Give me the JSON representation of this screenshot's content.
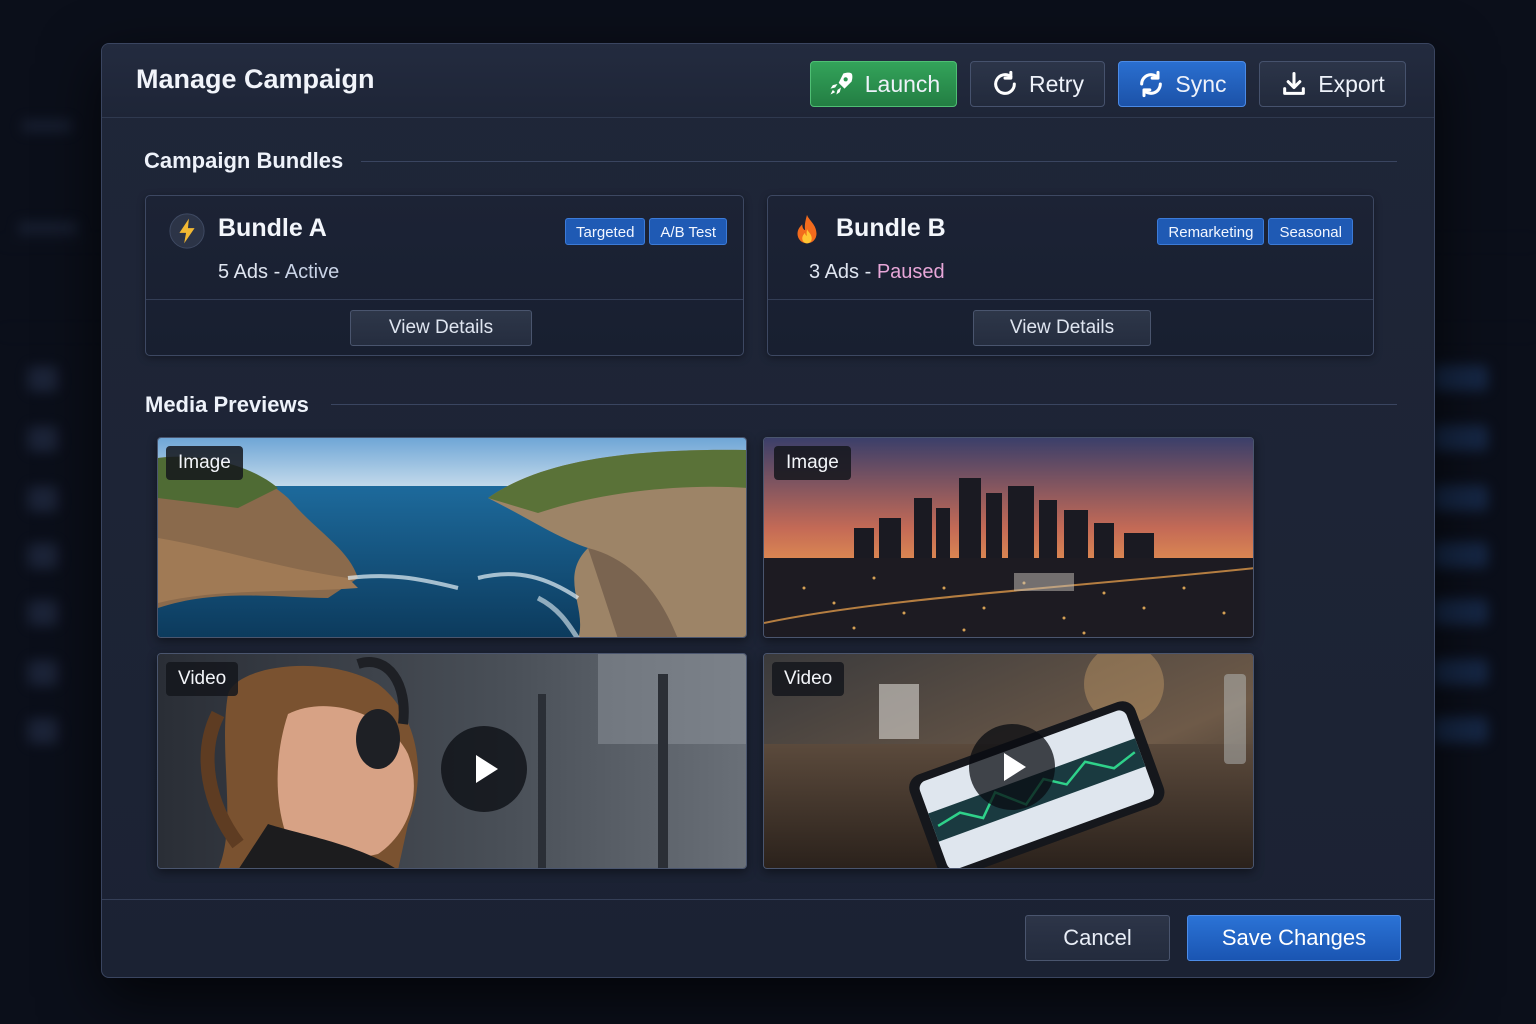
{
  "modal": {
    "title": "Manage Campaign"
  },
  "header_buttons": {
    "launch": "Launch",
    "retry": "Retry",
    "sync": "Sync",
    "export": "Export"
  },
  "sections": {
    "bundles_title": "Campaign Bundles",
    "media_title": "Media Previews"
  },
  "bundles": [
    {
      "name": "Bundle A",
      "icon": "lightning-icon",
      "ads_count": "5 Ads",
      "separator": "-",
      "status": "Active",
      "tags": [
        "Targeted",
        "A/B Test"
      ],
      "action": "View Details"
    },
    {
      "name": "Bundle B",
      "icon": "fire-icon",
      "ads_count": "3 Ads",
      "separator": "-",
      "status": "Paused",
      "tags": [
        "Remarketing",
        "Seasonal"
      ],
      "action": "View Details"
    }
  ],
  "media": [
    {
      "type": "Image",
      "subject": "coastal-cliffs"
    },
    {
      "type": "Image",
      "subject": "city-skyline-sunset"
    },
    {
      "type": "Video",
      "subject": "woman-headphones-gym"
    },
    {
      "type": "Video",
      "subject": "smartphone-on-table"
    }
  ],
  "footer": {
    "cancel": "Cancel",
    "save": "Save Changes"
  },
  "colors": {
    "accent_blue": "#1f5ab4",
    "launch_green": "#2a9450",
    "paused_pink": "#e7a6d8"
  }
}
